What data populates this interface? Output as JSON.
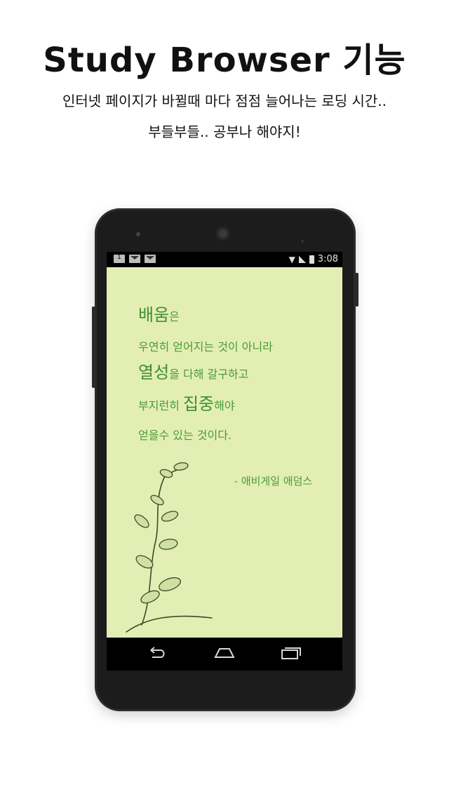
{
  "header": {
    "title": "Study Browser 기능",
    "subtitle_line1": "인터넷 페이지가 바뀔때 마다 점점 늘어나는 로딩 시간..",
    "subtitle_line2": "부들부들.. 공부나 해야지!"
  },
  "statusbar": {
    "time": "3:08",
    "notification_icons": [
      "calendar-icon",
      "gmail-icon",
      "email-icon"
    ],
    "status_icons": [
      "wifi-icon",
      "signal-icon",
      "battery-icon"
    ]
  },
  "quote": {
    "line1_big": "배움",
    "line1_rest": "은",
    "line2": "우연히 얻어지는 것이 아니라",
    "line3_big": "열성",
    "line3_rest": "을 다해 갈구하고",
    "line4_pre": "부지런히 ",
    "line4_big": "집중",
    "line4_rest": "해야",
    "line5": "얻을수 있는 것이다.",
    "author": "- 애비게일 애덤스"
  },
  "navbar": {
    "icons": [
      "back-icon",
      "home-icon",
      "recent-apps-icon"
    ]
  },
  "colors": {
    "screen_bg": "#e3eeb4",
    "quote_text": "#4a9a3a",
    "phone_body": "#1c1c1c"
  }
}
